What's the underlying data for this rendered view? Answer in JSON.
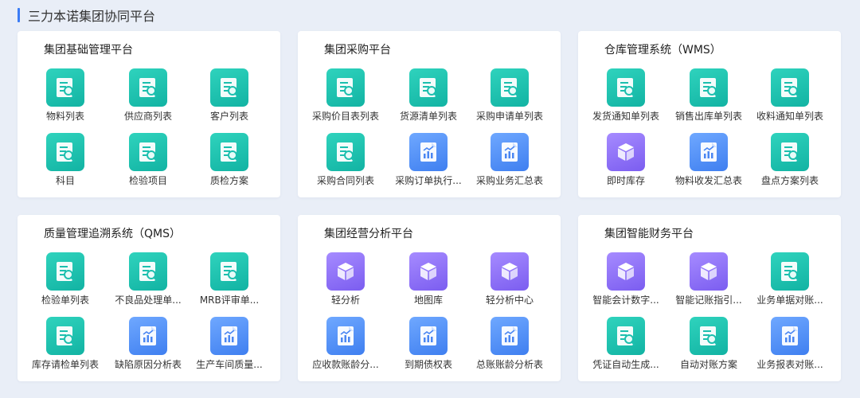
{
  "header": {
    "title": "三力本诺集团协同平台"
  },
  "cards": [
    {
      "title": "集团基础管理平台",
      "items": [
        {
          "label": "物料列表",
          "icon": "doc-search-icon",
          "color": "teal"
        },
        {
          "label": "供应商列表",
          "icon": "doc-search-icon",
          "color": "teal"
        },
        {
          "label": "客户列表",
          "icon": "doc-search-icon",
          "color": "teal"
        },
        {
          "label": "科目",
          "icon": "doc-search-icon",
          "color": "teal"
        },
        {
          "label": "检验项目",
          "icon": "doc-search-icon",
          "color": "teal"
        },
        {
          "label": "质检方案",
          "icon": "doc-search-icon",
          "color": "teal"
        }
      ]
    },
    {
      "title": "集团采购平台",
      "items": [
        {
          "label": "采购价目表列表",
          "icon": "doc-search-icon",
          "color": "teal"
        },
        {
          "label": "货源清单列表",
          "icon": "doc-search-icon",
          "color": "teal"
        },
        {
          "label": "采购申请单列表",
          "icon": "doc-search-icon",
          "color": "teal"
        },
        {
          "label": "采购合同列表",
          "icon": "doc-search-icon",
          "color": "teal"
        },
        {
          "label": "采购订单执行...",
          "icon": "report-chart-icon",
          "color": "blue"
        },
        {
          "label": "采购业务汇总表",
          "icon": "report-chart-icon",
          "color": "blue"
        }
      ]
    },
    {
      "title": "仓库管理系统（WMS）",
      "items": [
        {
          "label": "发货通知单列表",
          "icon": "doc-search-icon",
          "color": "teal"
        },
        {
          "label": "销售出库单列表",
          "icon": "doc-search-icon",
          "color": "teal"
        },
        {
          "label": "收料通知单列表",
          "icon": "doc-search-icon",
          "color": "teal"
        },
        {
          "label": "即时库存",
          "icon": "cube-icon",
          "color": "purple"
        },
        {
          "label": "物料收发汇总表",
          "icon": "report-chart-icon",
          "color": "blue"
        },
        {
          "label": "盘点方案列表",
          "icon": "doc-search-icon",
          "color": "teal"
        }
      ]
    },
    {
      "title": "质量管理追溯系统（QMS）",
      "items": [
        {
          "label": "检验单列表",
          "icon": "doc-search-icon",
          "color": "teal"
        },
        {
          "label": "不良品处理单...",
          "icon": "doc-search-icon",
          "color": "teal"
        },
        {
          "label": "MRB评审单...",
          "icon": "doc-search-icon",
          "color": "teal"
        },
        {
          "label": "库存请检单列表",
          "icon": "doc-search-icon",
          "color": "teal"
        },
        {
          "label": "缺陷原因分析表",
          "icon": "report-chart-icon",
          "color": "blue"
        },
        {
          "label": "生产车间质量...",
          "icon": "report-chart-icon",
          "color": "blue"
        }
      ]
    },
    {
      "title": "集团经营分析平台",
      "items": [
        {
          "label": "轻分析",
          "icon": "cube-icon",
          "color": "purple"
        },
        {
          "label": "地图库",
          "icon": "cube-icon",
          "color": "purple"
        },
        {
          "label": "轻分析中心",
          "icon": "cube-icon",
          "color": "purple"
        },
        {
          "label": "应收款账龄分...",
          "icon": "report-chart-icon",
          "color": "blue"
        },
        {
          "label": "到期债权表",
          "icon": "report-chart-icon",
          "color": "blue"
        },
        {
          "label": "总账账龄分析表",
          "icon": "report-chart-icon",
          "color": "blue"
        }
      ]
    },
    {
      "title": "集团智能财务平台",
      "items": [
        {
          "label": "智能会计数字...",
          "icon": "cube-icon",
          "color": "purple"
        },
        {
          "label": "智能记账指引...",
          "icon": "cube-icon",
          "color": "purple"
        },
        {
          "label": "业务单据对账...",
          "icon": "doc-search-icon",
          "color": "teal"
        },
        {
          "label": "凭证自动生成...",
          "icon": "doc-search-icon",
          "color": "teal"
        },
        {
          "label": "自动对账方案",
          "icon": "doc-search-icon",
          "color": "teal"
        },
        {
          "label": "业务报表对账...",
          "icon": "report-chart-icon",
          "color": "blue"
        }
      ]
    }
  ]
}
